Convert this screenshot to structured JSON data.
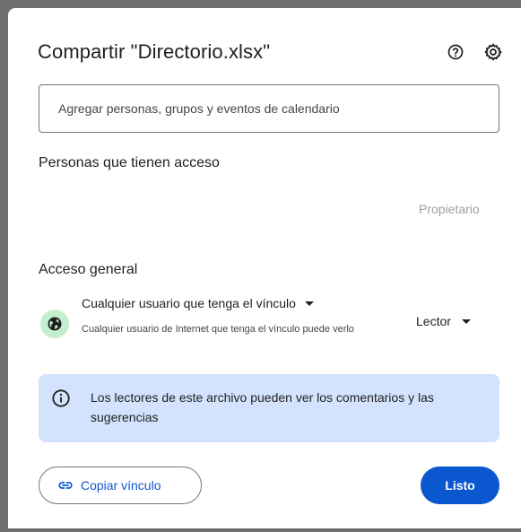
{
  "dialog": {
    "title": "Compartir \"Directorio.xlsx\"",
    "help_icon": "help-circle-icon",
    "settings_icon": "gear-icon"
  },
  "search": {
    "placeholder": "Agregar personas, grupos y eventos de calendario",
    "value": ""
  },
  "people": {
    "title": "Personas que tienen acceso",
    "owner_label": "Propietario"
  },
  "general_access": {
    "title": "Acceso general",
    "icon": "globe-icon",
    "link_setting": "Cualquier usuario que tenga el vínculo",
    "description": "Cualquier usuario de Internet que tenga el vínculo puede verlo",
    "role": "Lector"
  },
  "info": {
    "icon": "info-icon",
    "text": "Los lectores de este archivo pueden ver los comentarios y las sugerencias"
  },
  "footer": {
    "copy_label": "Copiar vínculo",
    "copy_icon": "link-icon",
    "done_label": "Listo"
  },
  "colors": {
    "accent": "#0b57d0",
    "info_background": "#d3e3fd",
    "globe_background": "#c4eed0"
  }
}
